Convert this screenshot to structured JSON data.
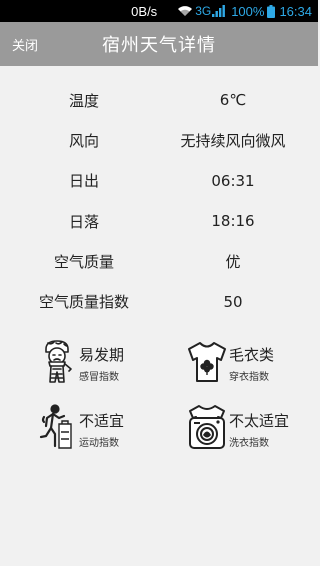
{
  "status_bar": {
    "net_speed": "0B/s",
    "network_type": "3G",
    "battery": "100%",
    "time": "16:34"
  },
  "title_bar": {
    "close_label": "关闭",
    "title": "宿州天气详情"
  },
  "details": [
    {
      "label": "温度",
      "value": "6℃"
    },
    {
      "label": "风向",
      "value": "无持续风向微风"
    },
    {
      "label": "日出",
      "value": "06:31"
    },
    {
      "label": "日落",
      "value": "18:16"
    },
    {
      "label": "空气质量",
      "value": "优"
    },
    {
      "label": "空气质量指数",
      "value": "50"
    }
  ],
  "indices": [
    {
      "title": "易发期",
      "subtitle": "感冒指数",
      "icon": "cold-person-icon"
    },
    {
      "title": "毛衣类",
      "subtitle": "穿衣指数",
      "icon": "tshirt-icon"
    },
    {
      "title": "不适宜",
      "subtitle": "运动指数",
      "icon": "running-person-icon"
    },
    {
      "title": "不太适宜",
      "subtitle": "洗衣指数",
      "icon": "washing-machine-icon"
    }
  ]
}
